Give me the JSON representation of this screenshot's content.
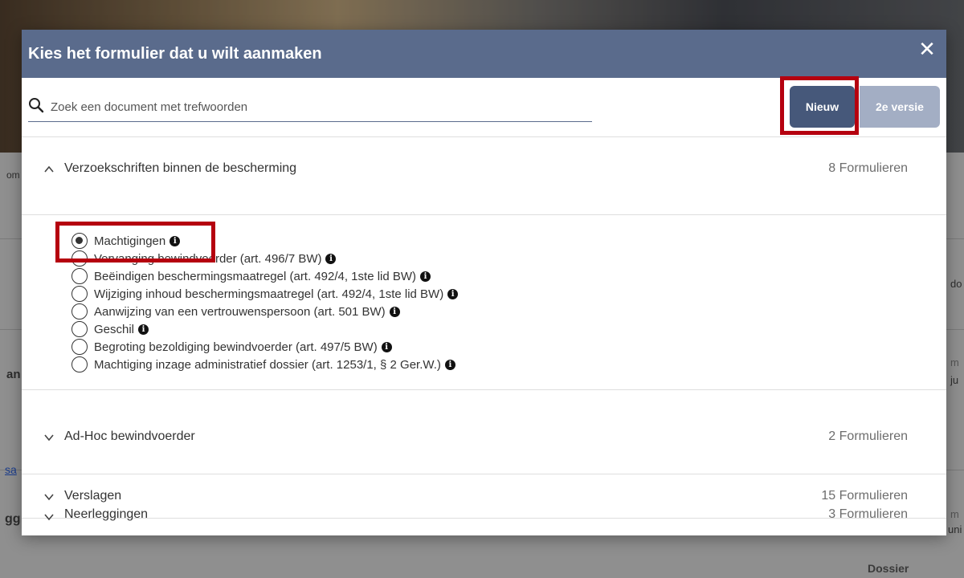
{
  "modal": {
    "title": "Kies het formulier dat u wilt aanmaken",
    "close_glyph": "✕"
  },
  "search": {
    "placeholder": "Zoek een document met trefwoorden",
    "value": ""
  },
  "buttons": {
    "new_label": "Nieuw",
    "version_label": "2e versie"
  },
  "sections": [
    {
      "title": "Verzoekschriften binnen de bescherming",
      "count": "8 Formulieren",
      "expanded": true
    },
    {
      "title": "Ad-Hoc bewindvoerder",
      "count": "2 Formulieren",
      "expanded": false
    },
    {
      "title": "Verslagen",
      "count": "15 Formulieren",
      "expanded": false
    },
    {
      "title": "Neerleggingen",
      "count": "3 Formulieren",
      "expanded": false
    }
  ],
  "forms": [
    {
      "label": "Machtigingen",
      "checked": true
    },
    {
      "label": "Vervanging bewindvoerder (art. 496/7 BW)",
      "checked": false
    },
    {
      "label": "Beëindigen beschermingsmaatregel (art. 492/4, 1ste lid BW)",
      "checked": false
    },
    {
      "label": "Wijziging inhoud beschermingsmaatregel (art. 492/4, 1ste lid BW)",
      "checked": false
    },
    {
      "label": "Aanwijzing van een vertrouwenspersoon (art. 501 BW)",
      "checked": false
    },
    {
      "label": "Geschil",
      "checked": false
    },
    {
      "label": "Begroting bezoldiging bewindvoerder (art. 497/5 BW)",
      "checked": false
    },
    {
      "label": "Machtiging inzage administratief dossier (art. 1253/1, § 2 Ger.W.)",
      "checked": false
    }
  ],
  "info_glyph": "i",
  "background": {
    "frag_om": "om",
    "frag_an": "an",
    "frag_sa": "sa",
    "frag_gg": "gg",
    "frag_do": "do",
    "frag_m1": "m",
    "frag_ju": "ju",
    "frag_m2": "m",
    "frag_un": "uni",
    "frag_dossier": "Dossier"
  },
  "colors": {
    "header": "#5a6b8c",
    "primary_button": "#46587a",
    "secondary_button": "#a3aec4",
    "highlight": "#b5000f"
  }
}
